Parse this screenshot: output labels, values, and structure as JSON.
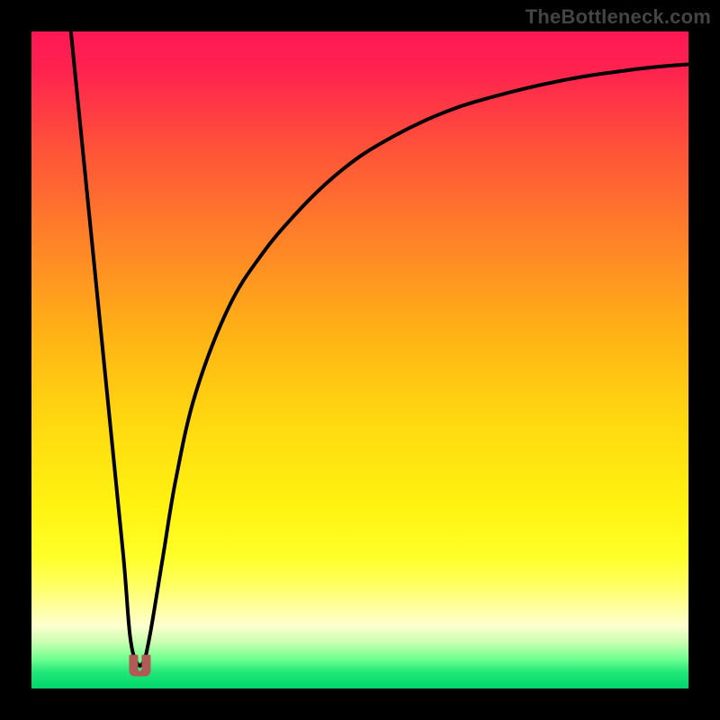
{
  "watermark": {
    "text": "TheBottleneck.com"
  },
  "chart_data": {
    "type": "line",
    "title": "",
    "xlabel": "",
    "ylabel": "",
    "xlim": [
      0,
      100
    ],
    "ylim": [
      0,
      100
    ],
    "grid": false,
    "series": [
      {
        "name": "bottleneck-curve",
        "x": [
          6,
          8,
          10,
          12,
          14,
          15,
          16,
          17,
          18,
          20,
          22,
          25,
          30,
          35,
          40,
          45,
          50,
          55,
          60,
          65,
          70,
          75,
          80,
          85,
          90,
          95,
          100
        ],
        "values": [
          100,
          80,
          60,
          40,
          20,
          8,
          4,
          4,
          8,
          20,
          32,
          45,
          58,
          66,
          72,
          77,
          81,
          84,
          86.5,
          88.5,
          90,
          91.3,
          92.4,
          93.3,
          94,
          94.6,
          95
        ]
      }
    ],
    "marker": {
      "name": "optimal-point",
      "x": 16.5,
      "y": 3.5,
      "color": "#b25a55"
    },
    "background_gradient": {
      "stops": [
        {
          "offset": 0.0,
          "color": "#ff1854"
        },
        {
          "offset": 0.06,
          "color": "#ff234f"
        },
        {
          "offset": 0.18,
          "color": "#ff5338"
        },
        {
          "offset": 0.32,
          "color": "#ff8328"
        },
        {
          "offset": 0.46,
          "color": "#ffb215"
        },
        {
          "offset": 0.6,
          "color": "#ffda10"
        },
        {
          "offset": 0.72,
          "color": "#fff210"
        },
        {
          "offset": 0.8,
          "color": "#ffff28"
        },
        {
          "offset": 0.85,
          "color": "#ffff70"
        },
        {
          "offset": 0.905,
          "color": "#fdffd0"
        },
        {
          "offset": 0.93,
          "color": "#c8ffb0"
        },
        {
          "offset": 0.955,
          "color": "#70ff90"
        },
        {
          "offset": 0.975,
          "color": "#20e878"
        },
        {
          "offset": 1.0,
          "color": "#00d66a"
        }
      ]
    }
  }
}
